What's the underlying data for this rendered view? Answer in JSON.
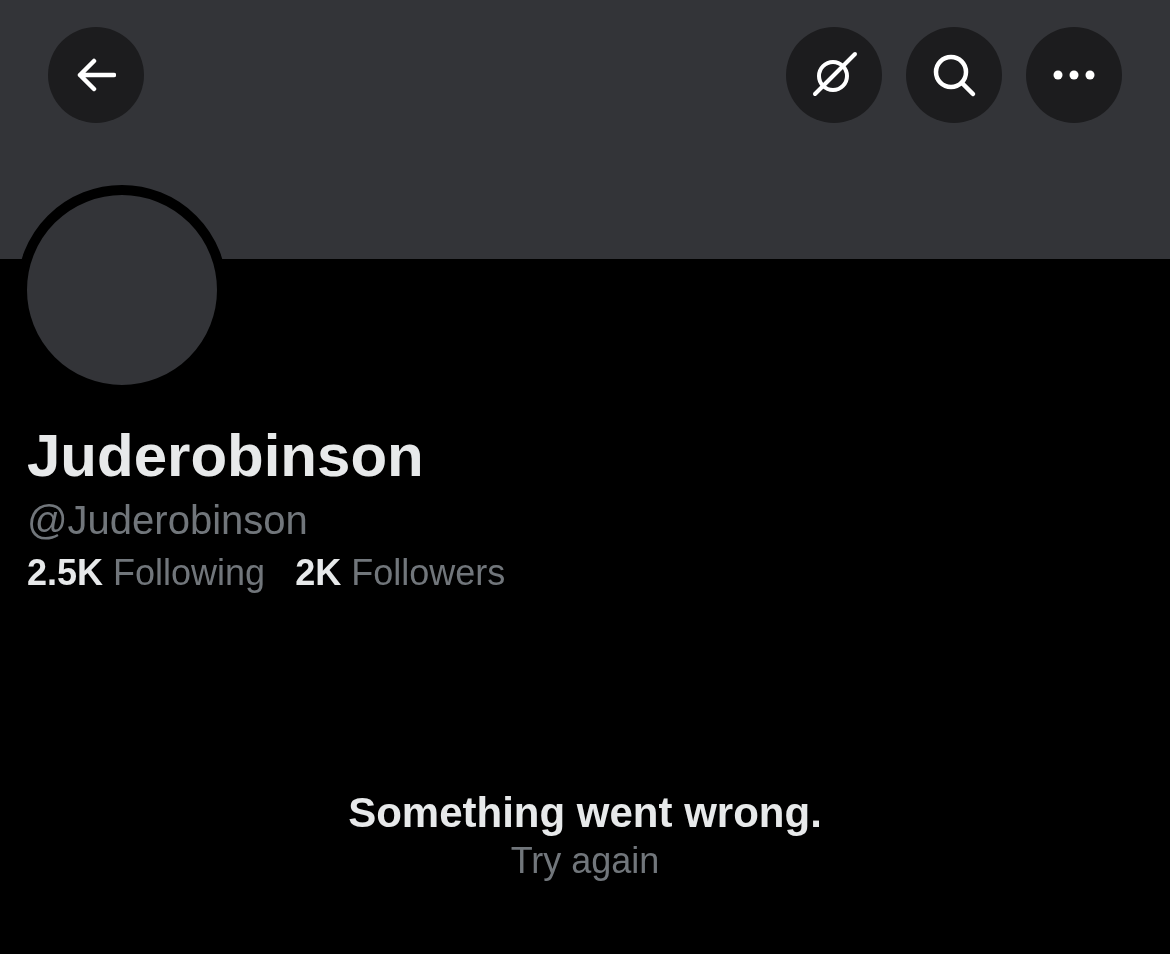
{
  "profile": {
    "name": "Juderobinson",
    "handle": "@Juderobinson",
    "stats": [
      {
        "count": "2.5K",
        "label": "Following"
      },
      {
        "count": "2K",
        "label": "Followers"
      }
    ]
  },
  "error": {
    "message": "Something went wrong.",
    "retry": "Try again"
  }
}
